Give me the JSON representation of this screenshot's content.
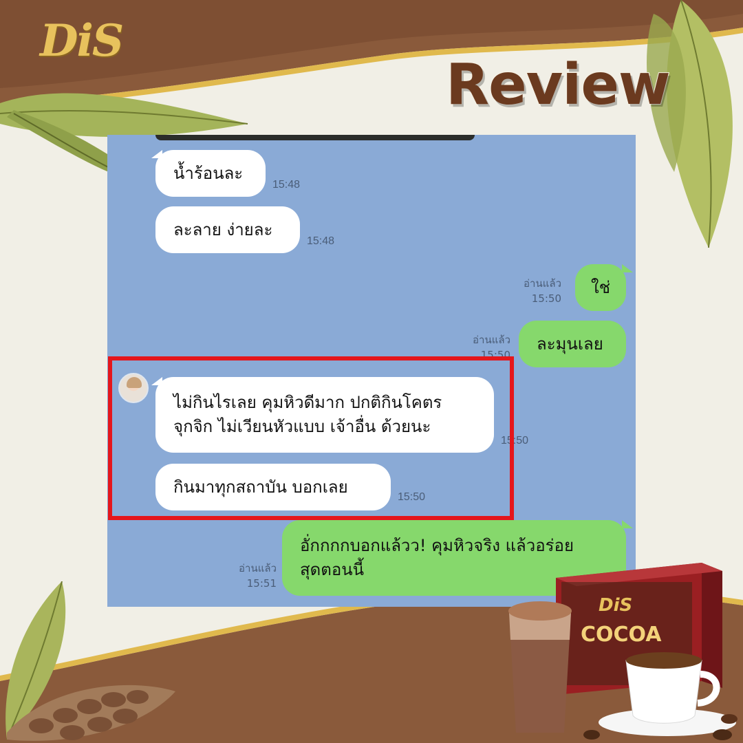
{
  "brand": {
    "logo_text": "DiS"
  },
  "header": {
    "title": "Review"
  },
  "colors": {
    "brown_dark": "#6b3a1f",
    "brown_band": "#8a5a3b",
    "gold": "#e8c25d",
    "chat_background": "#8aaad6",
    "incoming_bubble": "#ffffff",
    "outgoing_bubble": "#86d86c",
    "highlight": "#e5161b"
  },
  "chat": {
    "messages": [
      {
        "direction": "incoming",
        "text": "น้ำร้อนละ",
        "time": "15:48"
      },
      {
        "direction": "incoming",
        "text": "ละลาย ง่ายละ",
        "time": "15:48"
      },
      {
        "direction": "outgoing",
        "text": "ใช่",
        "read": "อ่านแล้ว",
        "time": "15:50"
      },
      {
        "direction": "outgoing",
        "text": "ละมุนเลย",
        "read": "อ่านแล้ว",
        "time": "15:50"
      },
      {
        "direction": "incoming",
        "line1": "ไม่กินไรเลย คุมหิวดีมาก ปกติกินโคตร",
        "line2": "จุกจิก  ไม่เวียนหัวแบบ เจ้าอื่น ด้วยนะ",
        "time": "15:50"
      },
      {
        "direction": "incoming",
        "text": "กินมาทุกสถาบัน บอกเลย",
        "time": "15:50"
      },
      {
        "direction": "outgoing",
        "line1": "อั่กกกกบอกแล้วว! คุมหิวจริง แล้วอร่อย",
        "line2": "สุดตอนนี้",
        "read": "อ่านแล้ว",
        "time": "15:51"
      }
    ]
  },
  "product": {
    "brand": "DiS",
    "name": "COCOA"
  }
}
